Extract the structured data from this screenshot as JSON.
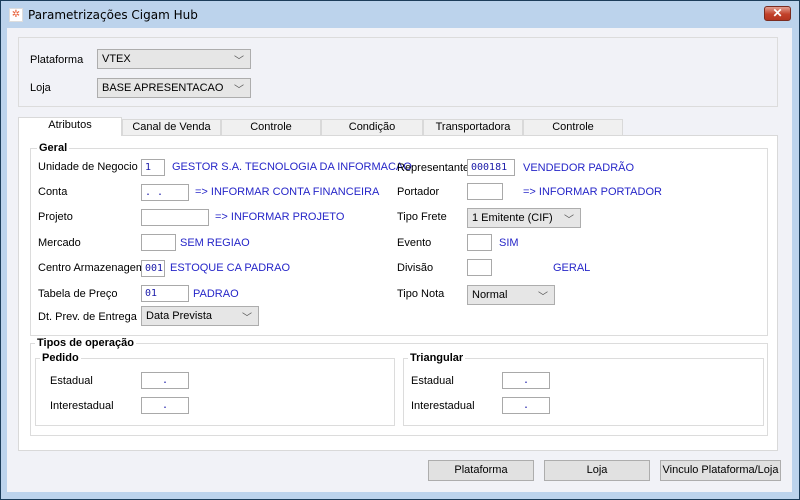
{
  "window": {
    "title": "Parametrizações Cigam Hub",
    "close_icon": "close-icon",
    "app_icon": "cigam-logo-icon"
  },
  "header": {
    "plataforma_label": "Plataforma",
    "plataforma_value": "VTEX",
    "loja_label": "Loja",
    "loja_value": "BASE APRESENTACAO"
  },
  "tabs": [
    {
      "label": "Atributos",
      "active": true
    },
    {
      "label": "Canal de Venda"
    },
    {
      "label": "Controle"
    },
    {
      "label": "Condição Pagamento"
    },
    {
      "label": "Transportadora"
    },
    {
      "label": "Controle Exportação"
    }
  ],
  "geral": {
    "title": "Geral",
    "unidade": {
      "label": "Unidade de Negocio",
      "value": "1",
      "desc": "GESTOR S.A. TECNOLOGIA DA INFORMACAO"
    },
    "conta": {
      "label": "Conta",
      "value": ". .",
      "desc": "=> INFORMAR CONTA FINANCEIRA"
    },
    "projeto": {
      "label": "Projeto",
      "value": "",
      "desc": "=> INFORMAR PROJETO"
    },
    "mercado": {
      "label": "Mercado",
      "value": "",
      "desc": "SEM REGIAO"
    },
    "centro": {
      "label": "Centro Armazenagem",
      "value": "001",
      "desc": "ESTOQUE CA PADRAO"
    },
    "tabela": {
      "label": "Tabela de Preço",
      "value": "01",
      "desc": "PADRAO"
    },
    "dtprev": {
      "label": "Dt. Prev. de Entrega",
      "value": "Data Prevista"
    },
    "representante": {
      "label": "Representante",
      "value": "000181",
      "desc": "VENDEDOR PADRÃO"
    },
    "portador": {
      "label": "Portador",
      "value": "",
      "desc": "=> INFORMAR PORTADOR"
    },
    "tipofrete": {
      "label": "Tipo Frete",
      "value": "1 Emitente (CIF)"
    },
    "evento": {
      "label": "Evento",
      "value": "",
      "desc": "SIM"
    },
    "divisao": {
      "label": "Divisão",
      "value": "",
      "desc": "GERAL"
    },
    "tiponota": {
      "label": "Tipo Nota",
      "value": "Normal"
    }
  },
  "tipos": {
    "title": "Tipos de operação",
    "pedido": {
      "title": "Pedido",
      "estadual_label": "Estadual",
      "estadual_value": ".",
      "inter_label": "Interestadual",
      "inter_value": "."
    },
    "triangular": {
      "title": "Triangular",
      "estadual_label": "Estadual",
      "estadual_value": ".",
      "inter_label": "Interestadual",
      "inter_value": "."
    }
  },
  "buttons": {
    "plataforma": "Plataforma",
    "loja": "Loja",
    "vinculo": "Vinculo Plataforma/Loja"
  }
}
